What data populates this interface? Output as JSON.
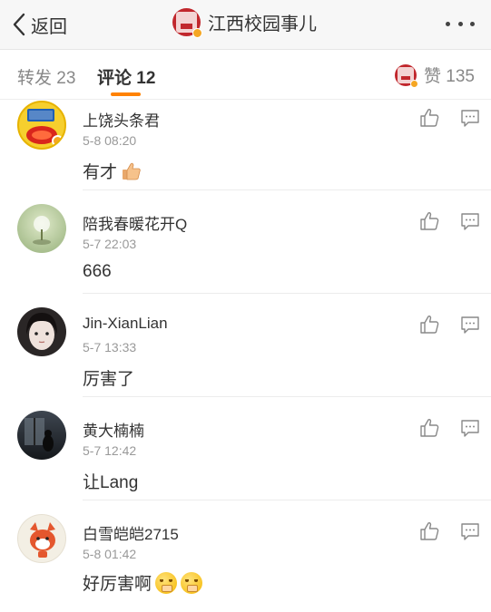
{
  "nav": {
    "back_label": "返回",
    "title": "江西校园事儿"
  },
  "tabs": {
    "repost": "转发 23",
    "comment": "评论 12",
    "like": "赞 135"
  },
  "colors": {
    "accent": "#ff8200",
    "brand_red": "#c1272d",
    "verified": "#f5a623"
  },
  "comments": [
    {
      "user": "上饶头条君",
      "time": "5-8 08:20",
      "text": "有才",
      "emoji": "thumbs-up"
    },
    {
      "user": "陪我春暖花开Q",
      "time": "5-7 22:03",
      "text": "666"
    },
    {
      "user": "Jin-XianLian",
      "time": "5-7 13:33",
      "text": "厉害了"
    },
    {
      "user": "黄大楠楠",
      "time": "5-7 12:42",
      "text": "让Lang"
    },
    {
      "user": "白雪皑皑2715",
      "time": "5-8 01:42",
      "text": "好厉害啊",
      "emoji": "shocked-face x2"
    }
  ]
}
